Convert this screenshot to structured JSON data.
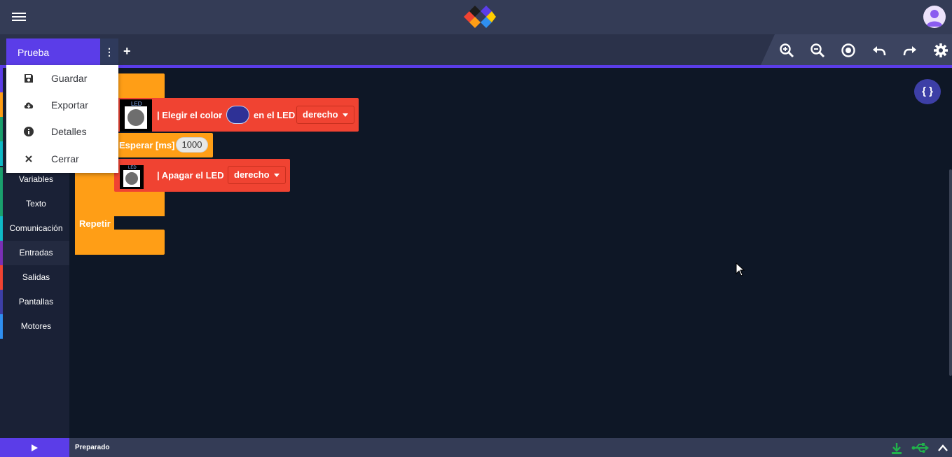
{
  "header": {
    "menu_icon": "hamburger-icon",
    "logo_icon": "bitbloq-logo-icon",
    "avatar_icon": "user-avatar-icon"
  },
  "tabs": {
    "active_tab_label": "Prueba",
    "kebab_icon": "kebab-menu-icon",
    "add_icon": "plus-icon"
  },
  "toolbar": {
    "items": [
      "zoom-in-icon",
      "zoom-out-icon",
      "center-icon",
      "undo-icon",
      "redo-icon",
      "settings-icon"
    ]
  },
  "tab_menu": {
    "items": [
      {
        "label": "Guardar",
        "icon": "save-icon"
      },
      {
        "label": "Exportar",
        "icon": "cloud-download-icon"
      },
      {
        "label": "Detalles",
        "icon": "info-icon"
      },
      {
        "label": "Cerrar",
        "icon": "close-icon"
      }
    ]
  },
  "sidebar": {
    "categories": [
      {
        "label": "Variables",
        "color": "#1aa06d"
      },
      {
        "label": "Texto",
        "color": "#1aa06d"
      },
      {
        "label": "Comunicación",
        "color": "#0fbac7"
      },
      {
        "label": "Entradas",
        "color": "#7a2fb5"
      },
      {
        "label": "Salidas",
        "color": "#f04332"
      },
      {
        "label": "Pantallas",
        "color": "#3d3fa6"
      },
      {
        "label": "Motores",
        "color": "#2f8ff0"
      }
    ],
    "active_category": "Entradas"
  },
  "workspace": {
    "blocks": {
      "set_led_color": {
        "label": "| Elegir el color",
        "mid_label": "en el LED",
        "dropdown": "derecho",
        "led_tag": "LED",
        "color": "#2e3196"
      },
      "wait": {
        "label": "Esperar [ms]",
        "value": "1000"
      },
      "led_off": {
        "label": "| Apagar el LED",
        "dropdown": "derecho",
        "led_tag": "LED"
      },
      "repeat": {
        "label": "Repetir"
      }
    },
    "code_button_label": "{ }"
  },
  "status": {
    "text": "Preparado",
    "icons": [
      "download-icon",
      "usb-icon",
      "chevron-up-icon"
    ],
    "run_icon": "play-icon"
  },
  "colors": {
    "accent": "#5b3de8",
    "orange_block": "#ff9e16",
    "red_block": "#f04332",
    "background": "#0e1726"
  }
}
